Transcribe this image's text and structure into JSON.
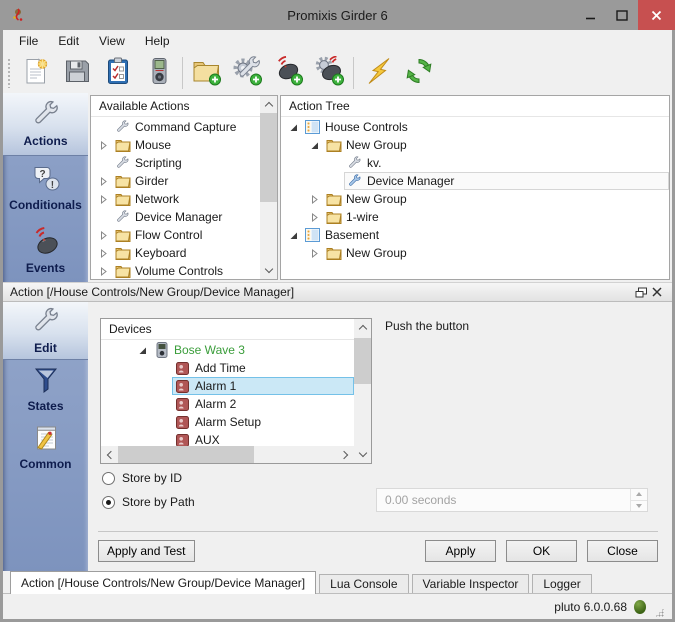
{
  "window": {
    "title": "Promixis Girder 6"
  },
  "menu": [
    "File",
    "Edit",
    "View",
    "Help"
  ],
  "toolbar": {
    "groups": [
      [
        "new-file",
        "save-file",
        "paste-actions",
        "remote-device"
      ],
      [
        "add-folder",
        "add-action",
        "add-event",
        "add-action-event"
      ],
      [
        "run-test",
        "refresh"
      ]
    ]
  },
  "nav_top": [
    {
      "label": "Actions",
      "icon": "wrench-xl",
      "selected": true
    },
    {
      "label": "Conditionals",
      "icon": "bubbles",
      "selected": false
    },
    {
      "label": "Events",
      "icon": "mouse-red",
      "selected": false
    }
  ],
  "available_actions": {
    "title": "Available Actions",
    "items": [
      {
        "label": "Command Capture",
        "icon": "wrench",
        "exp": "leaf",
        "depth": 0
      },
      {
        "label": "Mouse",
        "icon": "folder",
        "exp": "closed",
        "depth": 0
      },
      {
        "label": "Scripting",
        "icon": "wrench",
        "exp": "leaf",
        "depth": 0
      },
      {
        "label": "Girder",
        "icon": "folder",
        "exp": "closed",
        "depth": 0
      },
      {
        "label": "Network",
        "icon": "folder",
        "exp": "closed",
        "depth": 0
      },
      {
        "label": "Device Manager",
        "icon": "wrench",
        "exp": "leaf",
        "depth": 0
      },
      {
        "label": "Flow Control",
        "icon": "folder",
        "exp": "closed",
        "depth": 0
      },
      {
        "label": "Keyboard",
        "icon": "folder",
        "exp": "closed",
        "depth": 0
      },
      {
        "label": "Volume Controls",
        "icon": "folder",
        "exp": "closed",
        "depth": 0
      }
    ]
  },
  "action_tree": {
    "title": "Action Tree",
    "items": [
      {
        "label": "House Controls",
        "icon": "group",
        "exp": "open",
        "depth": 0
      },
      {
        "label": "New Group",
        "icon": "folder",
        "exp": "open",
        "depth": 1
      },
      {
        "label": "kv.",
        "icon": "wrench",
        "exp": "leaf",
        "depth": 2
      },
      {
        "label": "Device Manager",
        "icon": "wrench-blue",
        "exp": "leaf",
        "depth": 2,
        "selected": "subtle"
      },
      {
        "label": "New Group",
        "icon": "folder",
        "exp": "closed",
        "depth": 1
      },
      {
        "label": "1-wire",
        "icon": "folder",
        "exp": "closed",
        "depth": 1
      },
      {
        "label": "Basement",
        "icon": "group",
        "exp": "open",
        "depth": 0
      },
      {
        "label": "New Group",
        "icon": "folder",
        "exp": "closed",
        "depth": 1
      }
    ]
  },
  "dock": {
    "title": "Action [/House Controls/New Group/Device Manager]"
  },
  "nav_bottom": [
    {
      "label": "Edit",
      "icon": "wrench-xl",
      "selected": true
    },
    {
      "label": "States",
      "icon": "funnel",
      "selected": false
    },
    {
      "label": "Common",
      "icon": "notepad",
      "selected": false
    }
  ],
  "devices": {
    "title": "Devices",
    "items": [
      {
        "label": "Bose Wave 3",
        "icon": "device",
        "exp": "open",
        "depth": 1,
        "color": "green"
      },
      {
        "label": "Add Time",
        "icon": "command",
        "exp": "leaf",
        "depth": 2
      },
      {
        "label": "Alarm 1",
        "icon": "command",
        "exp": "leaf",
        "depth": 2,
        "selected": "active"
      },
      {
        "label": "Alarm 2",
        "icon": "command",
        "exp": "leaf",
        "depth": 2
      },
      {
        "label": "Alarm Setup",
        "icon": "command",
        "exp": "leaf",
        "depth": 2
      },
      {
        "label": "AUX",
        "icon": "command",
        "exp": "leaf",
        "depth": 2
      }
    ]
  },
  "editor": {
    "hint": "Push the button",
    "radio_id": {
      "label": "Store by ID",
      "checked": false
    },
    "radio_path": {
      "label": "Store by Path",
      "checked": true
    },
    "duration": {
      "value": "0.00 seconds",
      "disabled": true
    },
    "apply_test": "Apply and Test",
    "apply": "Apply",
    "ok": "OK",
    "close": "Close"
  },
  "tabs": [
    {
      "label": "Action [/House Controls/New Group/Device Manager]",
      "active": true
    },
    {
      "label": "Lua Console",
      "active": false
    },
    {
      "label": "Variable Inspector",
      "active": false
    },
    {
      "label": "Logger",
      "active": false
    }
  ],
  "status": {
    "text": "pluto 6.0.0.68",
    "indicator_color": "#4e7a22"
  }
}
